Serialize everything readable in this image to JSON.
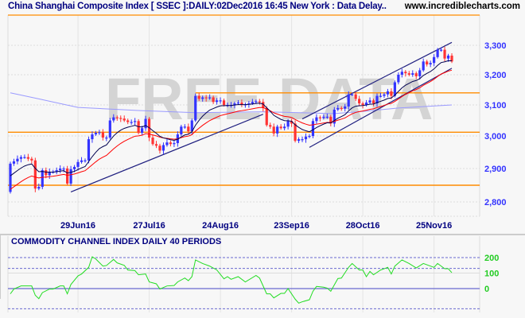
{
  "header": {
    "title": "China Shanghai Composite Index [ SSEC ]:DAILY:02Dec2016 16:45 New York : Data Delay..",
    "site": "www.incrediblecharts.com"
  },
  "watermark": "FREE DATA",
  "colors": {
    "up": "#3333ff",
    "down": "#ff3333",
    "ma_short": "#000050",
    "ma_mid": "#ff0000",
    "ma_long": "#9a9aff",
    "trendline": "#202080",
    "support": "#ff8c00",
    "cci": "#22dd22"
  },
  "chart_data": [
    {
      "type": "candlestick",
      "title": "China Shanghai Composite Index [ SSEC ]:DAILY",
      "y_ticks": [
        2800,
        2900,
        3000,
        3100,
        3200,
        3300
      ],
      "y_tick_labels": [
        "2,800",
        "2,900",
        "3,000",
        "3,100",
        "3,200",
        "3,300"
      ],
      "ylim": [
        2780,
        3340
      ],
      "x_ticks": [
        {
          "index": 19,
          "label": "29Jun16"
        },
        {
          "index": 39,
          "label": "27Jul16"
        },
        {
          "index": 59,
          "label": "24Aug16"
        },
        {
          "index": 79,
          "label": "23Sep16"
        },
        {
          "index": 99,
          "label": "28Oct16"
        },
        {
          "index": 119,
          "label": "25Nov16"
        }
      ],
      "grid": true,
      "closes": [
        2915,
        2922,
        2930,
        2935,
        2935,
        2930,
        2925,
        2840,
        2845,
        2895,
        2880,
        2890,
        2890,
        2895,
        2900,
        2900,
        2855,
        2898,
        2905,
        2920,
        2925,
        2925,
        2990,
        3005,
        3010,
        3012,
        2995,
        2995,
        3050,
        3060,
        3058,
        3056,
        3050,
        3045,
        3045,
        3048,
        3010,
        3025,
        3055,
        2995,
        2975,
        2970,
        2955,
        2972,
        2980,
        2975,
        2978,
        3005,
        3030,
        3030,
        3015,
        3050,
        3130,
        3120,
        3125,
        3122,
        3125,
        3110,
        3115,
        3115,
        3100,
        3100,
        3100,
        3105,
        3108,
        3100,
        3102,
        3105,
        3110,
        3112,
        3110,
        3090,
        3035,
        3030,
        3008,
        3030,
        3025,
        3030,
        3048,
        3040,
        2985,
        2990,
        2990,
        2998,
        3000,
        3048,
        3060,
        3058,
        3062,
        3062,
        3040,
        3085,
        3090,
        3088,
        3095,
        3135,
        3135,
        3120,
        3105,
        3100,
        3108,
        3115,
        3105,
        3130,
        3130,
        3135,
        3145,
        3130,
        3175,
        3200,
        3210,
        3205,
        3200,
        3205,
        3195,
        3215,
        3245,
        3235,
        3240,
        3260,
        3285,
        3285,
        3255,
        3265,
        3245
      ],
      "ma_short_period": 10,
      "ma_mid_period": 21,
      "ma_long": [
        [
          0,
          3140
        ],
        [
          8,
          3120
        ],
        [
          19,
          3092
        ],
        [
          36,
          3082
        ],
        [
          52,
          3075
        ],
        [
          71,
          3078
        ],
        [
          91,
          3072
        ],
        [
          100,
          3080
        ],
        [
          109,
          3090
        ],
        [
          124,
          3100
        ]
      ],
      "support_lines": [
        {
          "price": 3140,
          "from_index": 52
        },
        {
          "price": 3012,
          "from_index": -1
        },
        {
          "price": 2850,
          "from_index": -1
        }
      ],
      "trendlines": [
        {
          "from": [
            17,
            2830
          ],
          "to": [
            71,
            3070
          ]
        },
        {
          "from": [
            82,
            3055
          ],
          "to": [
            124,
            3310
          ]
        },
        {
          "from": [
            84,
            2965
          ],
          "to": [
            124,
            3222
          ]
        }
      ]
    },
    {
      "type": "line",
      "title": "COMMODITY CHANNEL INDEX DAILY 40 PERIODS",
      "y_ticks": [
        0,
        100,
        200
      ],
      "y_tick_labels": [
        "0",
        "100",
        "200"
      ],
      "overbought": 130,
      "oversold": -130,
      "points": [
        [
          0,
          -34
        ],
        [
          1,
          -3
        ],
        [
          3,
          17
        ],
        [
          6,
          17
        ],
        [
          7,
          -43
        ],
        [
          8,
          -65
        ],
        [
          9,
          -26
        ],
        [
          11,
          -3
        ],
        [
          12,
          -3
        ],
        [
          14,
          17
        ],
        [
          15,
          17
        ],
        [
          16,
          -34
        ],
        [
          17,
          26
        ],
        [
          19,
          82
        ],
        [
          20,
          94
        ],
        [
          22,
          137
        ],
        [
          23,
          205
        ],
        [
          24,
          191
        ],
        [
          26,
          145
        ],
        [
          27,
          149
        ],
        [
          29,
          188
        ],
        [
          30,
          166
        ],
        [
          32,
          150
        ],
        [
          33,
          120
        ],
        [
          35,
          116
        ],
        [
          36,
          89
        ],
        [
          38,
          94
        ],
        [
          39,
          43
        ],
        [
          41,
          31
        ],
        [
          42,
          -3
        ],
        [
          44,
          17
        ],
        [
          46,
          20
        ],
        [
          47,
          43
        ],
        [
          49,
          68
        ],
        [
          50,
          51
        ],
        [
          51,
          77
        ],
        [
          52,
          185
        ],
        [
          54,
          162
        ],
        [
          56,
          145
        ],
        [
          58,
          120
        ],
        [
          60,
          63
        ],
        [
          61,
          77
        ],
        [
          62,
          60
        ],
        [
          64,
          77
        ],
        [
          66,
          43
        ],
        [
          69,
          85
        ],
        [
          70,
          68
        ],
        [
          72,
          -34
        ],
        [
          73,
          -34
        ],
        [
          74,
          -60
        ],
        [
          76,
          -31
        ],
        [
          77,
          -31
        ],
        [
          78,
          0
        ],
        [
          80,
          -68
        ],
        [
          81,
          -94
        ],
        [
          82,
          -85
        ],
        [
          84,
          -72
        ],
        [
          85,
          -17
        ],
        [
          86,
          14
        ],
        [
          88,
          9
        ],
        [
          89,
          3
        ],
        [
          90,
          -17
        ],
        [
          92,
          65
        ],
        [
          93,
          68
        ],
        [
          95,
          137
        ],
        [
          96,
          162
        ],
        [
          98,
          120
        ],
        [
          99,
          120
        ],
        [
          100,
          77
        ],
        [
          101,
          111
        ],
        [
          102,
          89
        ],
        [
          104,
          120
        ],
        [
          105,
          128
        ],
        [
          106,
          137
        ],
        [
          107,
          94
        ],
        [
          108,
          145
        ],
        [
          110,
          185
        ],
        [
          112,
          162
        ],
        [
          114,
          133
        ],
        [
          116,
          162
        ],
        [
          119,
          137
        ],
        [
          120,
          162
        ],
        [
          122,
          128
        ],
        [
          123,
          128
        ],
        [
          124,
          103
        ]
      ]
    }
  ]
}
